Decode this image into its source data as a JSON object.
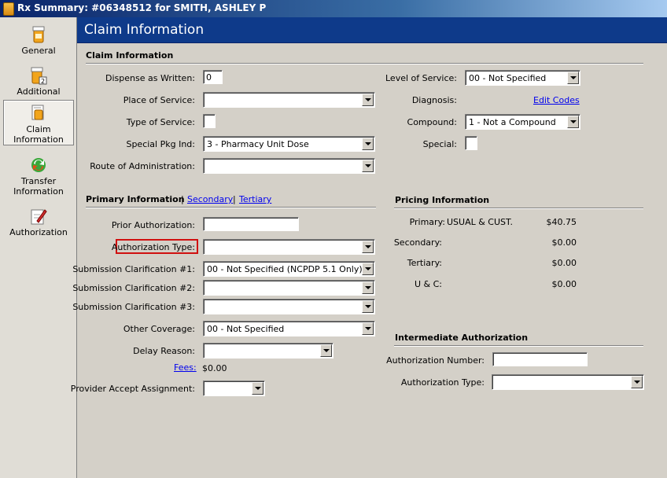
{
  "window": {
    "title": "Rx Summary: #06348512 for SMITH, ASHLEY P"
  },
  "sidebar": {
    "items": [
      {
        "label": "General",
        "icon": "pill-bottle-icon"
      },
      {
        "label": "Additional",
        "icon": "pill-bottle-number-icon"
      },
      {
        "label": "Claim Information",
        "icon": "claim-document-icon",
        "selected": true
      },
      {
        "label": "Transfer Information",
        "icon": "transfer-arrows-icon"
      },
      {
        "label": "Authorization",
        "icon": "authorization-pen-icon"
      }
    ]
  },
  "header": {
    "title": "Claim Information"
  },
  "claim": {
    "section_title": "Claim Information",
    "daw_label": "Dispense as Written:",
    "daw_value": "0",
    "pos_label": "Place of Service:",
    "pos_value": "",
    "tos_label": "Type of Service:",
    "spi_label": "Special Pkg Ind:",
    "spi_value": "3 - Pharmacy Unit Dose",
    "roa_label": "Route of Administration:",
    "roa_value": "",
    "los_label": "Level of Service:",
    "los_value": "00 - Not Specified",
    "diagnosis_label": "Diagnosis:",
    "edit_codes": "Edit Codes",
    "compound_label": "Compound:",
    "compound_value": "1 - Not a Compound",
    "special_label": "Special:"
  },
  "primary": {
    "section_title": "Primary Information",
    "sep": "|",
    "link_secondary": "Secondary",
    "link_tertiary": "Tertiary",
    "prior_auth_label": "Prior Authorization:",
    "prior_auth_value": "",
    "auth_type_label": "Authorization Type:",
    "auth_type_value": "",
    "sc1_label": "Submission Clarification #1:",
    "sc1_value": "00 - Not Specified (NCPDP 5.1 Only)",
    "sc2_label": "Submission Clarification #2:",
    "sc2_value": "",
    "sc3_label": "Submission Clarification #3:",
    "sc3_value": "",
    "other_cov_label": "Other Coverage:",
    "other_cov_value": "00 - Not Specified",
    "delay_label": "Delay Reason:",
    "delay_value": "",
    "fees_link": "Fees:",
    "fees_value": "$0.00",
    "paa_label": "Provider Accept Assignment:",
    "paa_value": ""
  },
  "pricing": {
    "section_title": "Pricing Information",
    "primary_label": "Primary:",
    "primary_desc": "USUAL & CUST.",
    "primary_value": "$40.75",
    "secondary_label": "Secondary:",
    "secondary_value": "$0.00",
    "tertiary_label": "Tertiary:",
    "tertiary_value": "$0.00",
    "uc_label": "U & C:",
    "uc_value": "$0.00"
  },
  "intermediate": {
    "section_title": "Intermediate Authorization",
    "auth_number_label": "Authorization Number:",
    "auth_number_value": "",
    "auth_type_label": "Authorization Type:",
    "auth_type_value": ""
  },
  "colors": {
    "header_band": "#0e3a8a",
    "highlight": "#d01010",
    "link": "#0000ee"
  }
}
